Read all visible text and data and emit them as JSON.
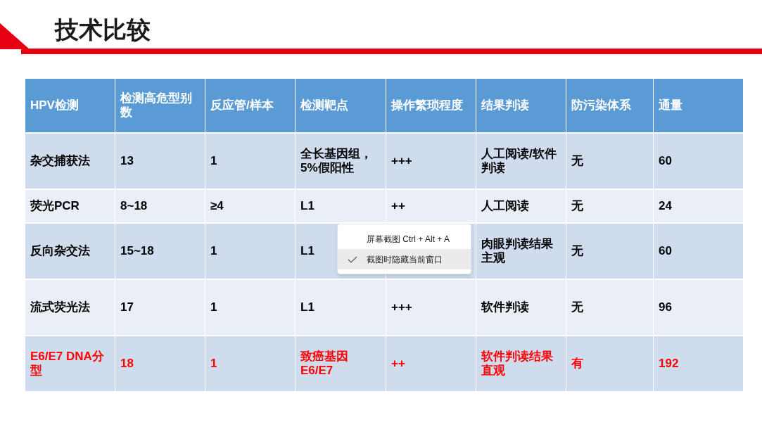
{
  "title": "技术比较",
  "table": {
    "columns": [
      "HPV检测",
      "检测高危型别数",
      "反应管/样本",
      "检测靶点",
      "操作繁琐程度",
      "结果判读",
      "防污染体系",
      "通量"
    ],
    "rows": [
      {
        "highlight": false,
        "cells": [
          "杂交捕获法",
          "13",
          "1",
          "全长基因组，5%假阳性",
          "+++",
          "人工阅读/软件判读",
          "无",
          "60"
        ]
      },
      {
        "highlight": false,
        "cells": [
          "荧光PCR",
          "8~18",
          "≥4",
          "L1",
          "++",
          "人工阅读",
          "无",
          "24"
        ]
      },
      {
        "highlight": false,
        "cells": [
          "反向杂交法",
          "15~18",
          "1",
          "L1",
          null,
          "肉眼判读结果主观",
          "无",
          "60"
        ]
      },
      {
        "highlight": false,
        "cells": [
          "流式荧光法",
          "17",
          "1",
          "L1",
          "+++",
          "软件判读",
          "无",
          "96"
        ]
      },
      {
        "highlight": true,
        "cells": [
          "E6/E7 DNA分型",
          "18",
          "1",
          "致癌基因E6/E7",
          "++",
          "软件判读结果直观",
          "有",
          "192"
        ]
      }
    ]
  },
  "context_menu": {
    "items": [
      {
        "label": "屏幕截图 Ctrl + Alt + A",
        "checked": false,
        "selected": false
      },
      {
        "label": "截图时隐藏当前窗口",
        "checked": true,
        "selected": true
      }
    ]
  }
}
